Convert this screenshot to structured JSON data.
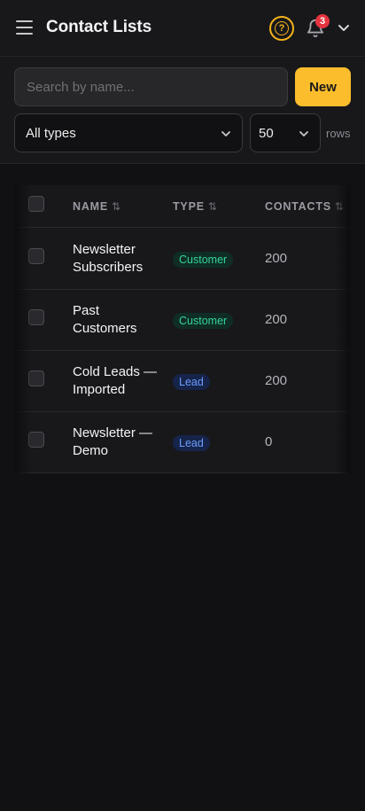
{
  "header": {
    "title": "Contact Lists",
    "notification_count": "3",
    "help_glyph": "?",
    "icons": [
      "menu-icon",
      "help-icon",
      "bell-icon",
      "chevron-down-icon"
    ],
    "accent_color": "#fbbd2b"
  },
  "filters": {
    "search_placeholder": "Search by name...",
    "new_button": "New",
    "type_filter": "All types",
    "rows_per_page": "50",
    "rows_label": "rows"
  },
  "table": {
    "columns": [
      "NAME",
      "TYPE",
      "CONTACTS"
    ],
    "sort_glyph": "⇅",
    "rows": [
      {
        "name": "Newsletter Subscribers",
        "type": "Customer",
        "contacts": "200"
      },
      {
        "name": "Past Customers",
        "type": "Customer",
        "contacts": "200"
      },
      {
        "name": "Cold Leads — Imported",
        "type": "Lead",
        "contacts": "200"
      },
      {
        "name": "Newsletter — Demo",
        "type": "Lead",
        "contacts": "0"
      }
    ]
  }
}
